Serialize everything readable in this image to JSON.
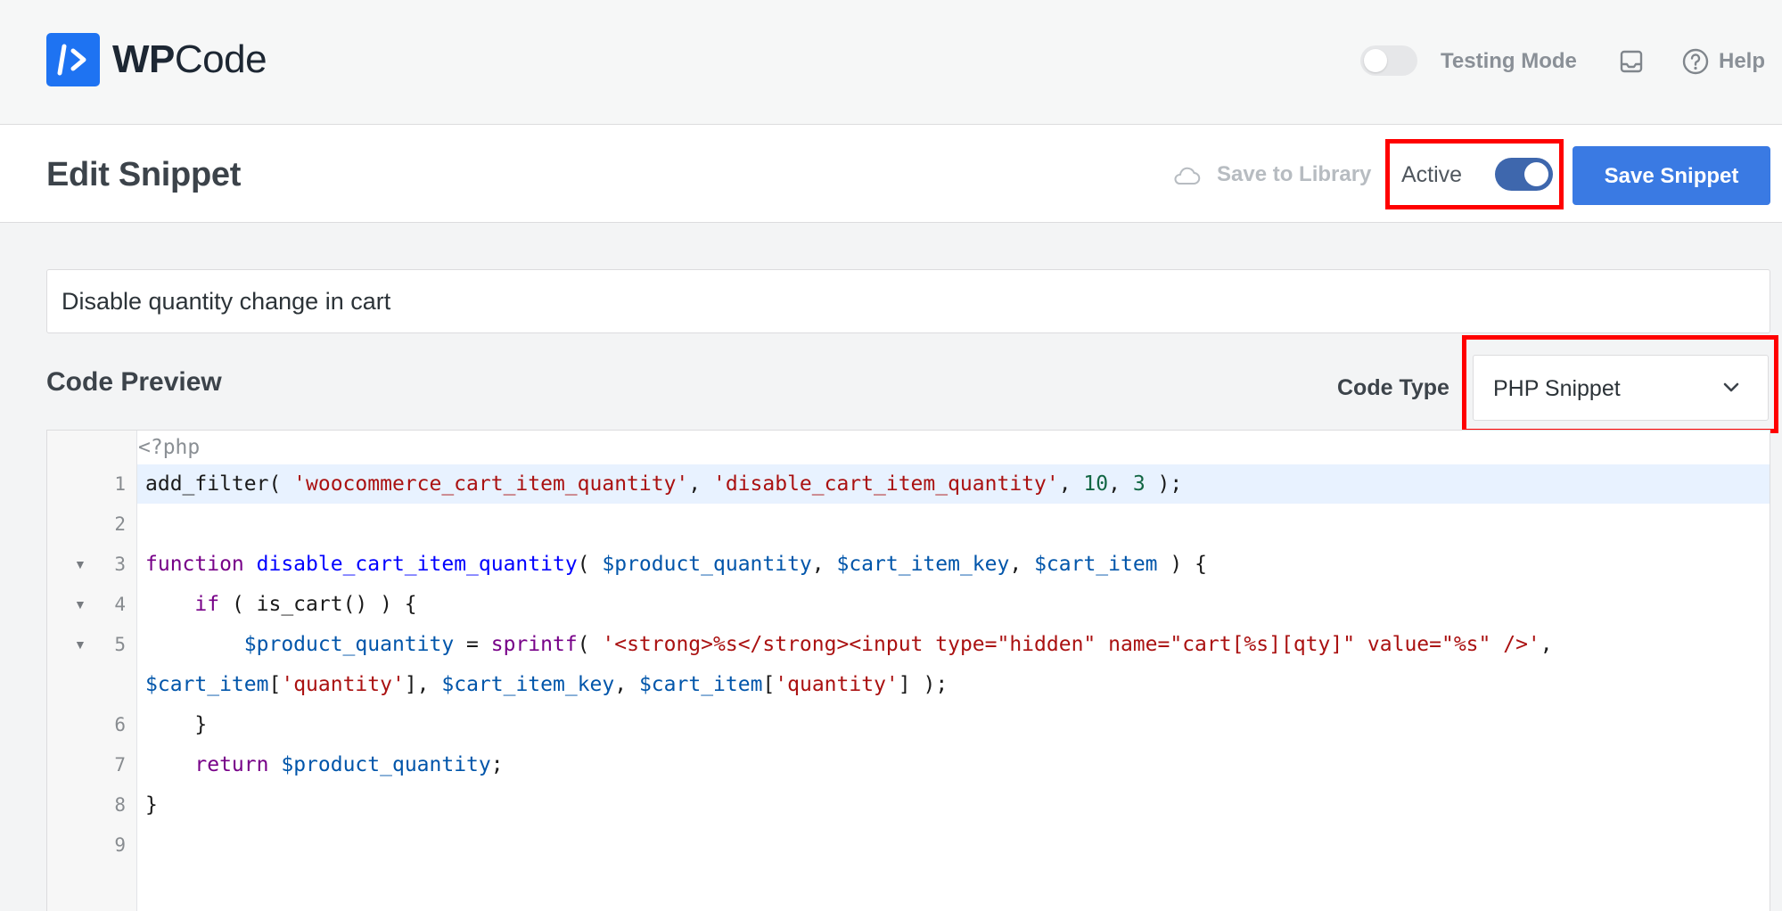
{
  "brand": {
    "wp": "WP",
    "code": "Code"
  },
  "topbar": {
    "testing_mode_label": "Testing Mode",
    "help_label": "Help"
  },
  "header": {
    "title": "Edit Snippet",
    "save_library_label": "Save to Library",
    "active_label": "Active",
    "save_button": "Save Snippet"
  },
  "snippet": {
    "title_value": "Disable quantity change in cart"
  },
  "code_preview": {
    "heading": "Code Preview",
    "code_type_label": "Code Type",
    "code_type_value": "PHP Snippet"
  },
  "editor": {
    "php_open": "<?php",
    "line_numbers": [
      "1",
      "2",
      "3",
      "4",
      "5",
      "6",
      "7",
      "8",
      "9"
    ],
    "lines": {
      "l1": [
        "add_filter( ",
        "'woocommerce_cart_item_quantity'",
        ", ",
        "'disable_cart_item_quantity'",
        ", ",
        "10",
        ", ",
        "3",
        " );"
      ],
      "l3": [
        "function",
        " ",
        "disable_cart_item_quantity",
        "( ",
        "$product_quantity",
        ", ",
        "$cart_item_key",
        ", ",
        "$cart_item",
        " ) {"
      ],
      "l4": [
        "    ",
        "if",
        " ( is_cart() ) {"
      ],
      "l5": [
        "        ",
        "$product_quantity",
        " = ",
        "sprintf",
        "( ",
        "'<strong>%s</strong><input type=\"hidden\" name=\"cart[%s][qty]\" value=\"%s\" />'",
        ","
      ],
      "l5b": [
        "$cart_item",
        "[",
        "'quantity'",
        "], ",
        "$cart_item_key",
        ", ",
        "$cart_item",
        "[",
        "'quantity'",
        "] );"
      ],
      "l6": [
        "    }"
      ],
      "l7": [
        "    ",
        "return",
        " ",
        "$product_quantity",
        ";"
      ],
      "l8": [
        "}"
      ]
    }
  },
  "icons": {
    "logo": "code-slash-icon",
    "inbox": "inbox-icon",
    "help": "help-circle-icon",
    "cloud": "cloud-icon",
    "chevron": "chevron-down-icon",
    "fold": "fold-triangle-icon"
  },
  "colors": {
    "brand_blue": "#1e73f2",
    "save_button": "#3a7ae3",
    "toggle_on": "#3e67ad",
    "highlight_box": "#ff0000",
    "keyword": "#770088",
    "string": "#aa1111",
    "variable": "#0055aa",
    "function_name": "#0000ff",
    "number": "#116644"
  },
  "state": {
    "testing_mode": false,
    "active": true
  }
}
